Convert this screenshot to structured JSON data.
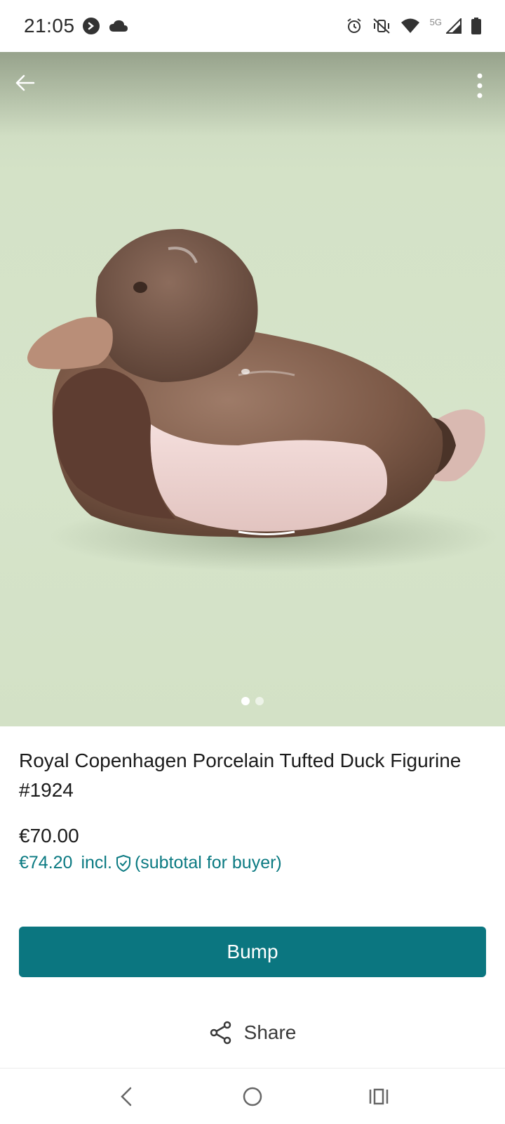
{
  "status_bar": {
    "time": "21:05",
    "network": "5G",
    "icons": [
      "notification-icon",
      "cloud-icon",
      "alarm-icon",
      "vibrate-off-icon",
      "wifi-icon",
      "signal-icon",
      "battery-icon"
    ]
  },
  "gallery": {
    "image_count": 2,
    "active_index": 0
  },
  "listing": {
    "title": "Royal Copenhagen Porcelain Tufted Duck Figurine #1924",
    "price": "€70.00",
    "buyer_price": "€74.20",
    "incl_label": "incl.",
    "subtotal_note": "(subtotal for buyer)"
  },
  "actions": {
    "bump_label": "Bump",
    "share_label": "Share"
  },
  "colors": {
    "accent": "#0b7680",
    "accent_text": "#0b7a82"
  }
}
